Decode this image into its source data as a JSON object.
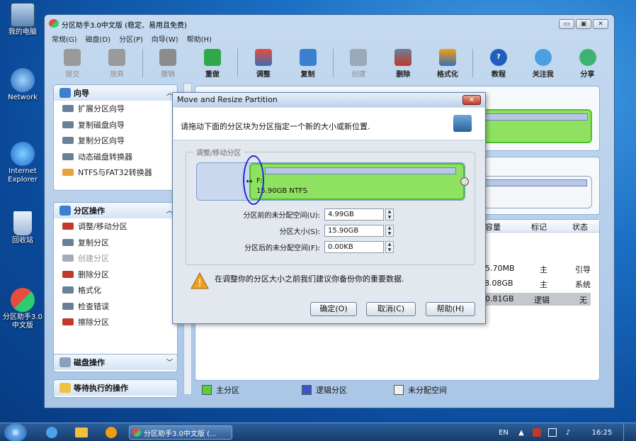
{
  "desktop": {
    "icons": [
      {
        "label": "我的电脑",
        "name": "computer-desktop-icon"
      },
      {
        "label": "Network",
        "name": "network-desktop-icon"
      },
      {
        "label": "Internet Explorer",
        "name": "internet-explorer-desktop-icon"
      },
      {
        "label": "回收站",
        "name": "recycle-bin-desktop-icon"
      },
      {
        "label": "分区助手3.0中文版",
        "name": "partition-assistant-desktop-icon"
      }
    ]
  },
  "app": {
    "title": "分区助手3.0中文版 (稳定、易用且免费)",
    "menu": [
      "常规(G)",
      "磁盘(D)",
      "分区(P)",
      "向导(W)",
      "帮助(H)"
    ],
    "toolbar": [
      {
        "label": "提交",
        "enabled": false
      },
      {
        "label": "放弃",
        "enabled": false
      },
      {
        "label": "撤销",
        "enabled": false
      },
      {
        "label": "重做",
        "enabled": true
      },
      {
        "label": "调整",
        "enabled": true
      },
      {
        "label": "复制",
        "enabled": true
      },
      {
        "label": "创建",
        "enabled": false
      },
      {
        "label": "删除",
        "enabled": true
      },
      {
        "label": "格式化",
        "enabled": true
      },
      {
        "label": "教程",
        "enabled": true
      },
      {
        "label": "关注我",
        "enabled": true
      },
      {
        "label": "分享",
        "enabled": true
      }
    ]
  },
  "sidebar": {
    "wizard": {
      "title": "向导",
      "items": [
        "扩展分区向导",
        "复制磁盘向导",
        "复制分区向导",
        "动态磁盘转换器",
        "NTFS与FAT32转换器"
      ]
    },
    "partition_ops": {
      "title": "分区操作",
      "items": [
        "调整/移动分区",
        "复制分区",
        "创建分区",
        "删除分区",
        "格式化",
        "检查错误",
        "擦除分区"
      ],
      "disabled": [
        "创建分区"
      ]
    },
    "disk_ops": {
      "title": "磁盘操作"
    },
    "pending": {
      "title": "等待执行的操作"
    }
  },
  "table": {
    "headers": [
      "用容量",
      "标记",
      "状态"
    ],
    "rows": [
      [
        "75.70MB",
        "主",
        "引导"
      ],
      [
        "8.08GB",
        "主",
        "系统"
      ],
      [
        "20.81GB",
        "逻辑",
        "无"
      ]
    ]
  },
  "legend": [
    "主分区",
    "逻辑分区",
    "未分配空间"
  ],
  "legend_colors": [
    "#5bcf3a",
    "#3b55c8",
    "#f2f2f2"
  ],
  "dialog": {
    "title": "Move and Resize Partition",
    "message": "请拖动下面的分区块为分区指定一个新的大小或新位置.",
    "group_label": "调整/移动分区",
    "partition_letter": "F:",
    "partition_info": "15.90GB NTFS",
    "fields": [
      {
        "label": "分区前的未分配空间(U):",
        "value": "4.99GB"
      },
      {
        "label": "分区大小(S):",
        "value": "15.90GB"
      },
      {
        "label": "分区后的未分配空间(F):",
        "value": "0.00KB"
      }
    ],
    "warning": "在调整你的分区大小之前我们建议你备份你的重要数据.",
    "buttons": {
      "ok": "确定(O)",
      "cancel": "取消(C)",
      "help": "帮助(H)"
    }
  },
  "taskbar": {
    "task_label": "分区助手3.0中文版 (...",
    "lang": "EN",
    "time": "16:25"
  }
}
